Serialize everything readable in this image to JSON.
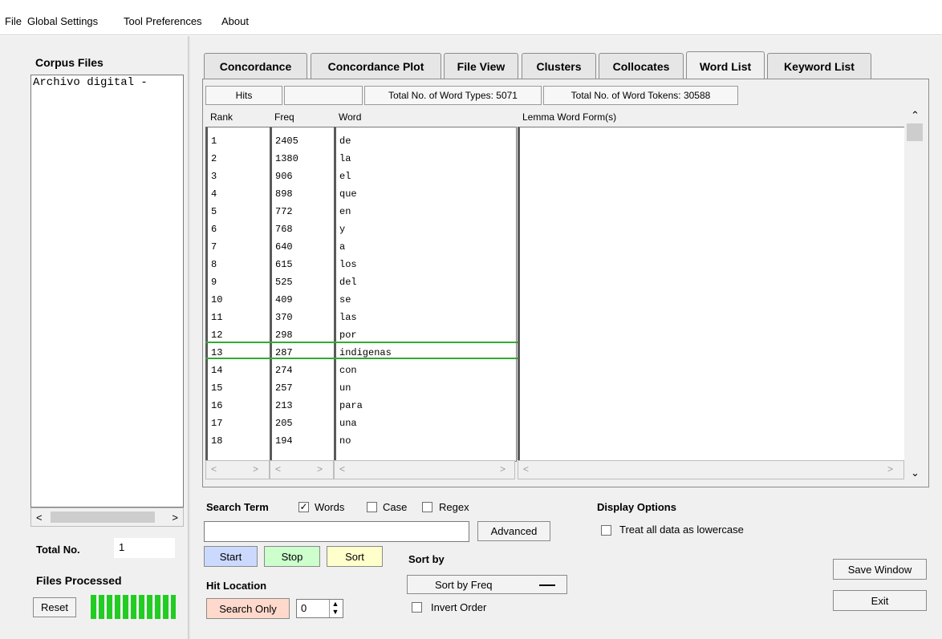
{
  "menu": [
    "File",
    "Global Settings",
    "Tool Preferences",
    "About"
  ],
  "sidebar": {
    "title": "Corpus Files",
    "file_item": "Archivo digital -",
    "total_label": "Total No.",
    "total_value": "1",
    "processed_label": "Files Processed",
    "reset_label": "Reset",
    "progress": 1.0
  },
  "tabs": [
    "Concordance",
    "Concordance Plot",
    "File View",
    "Clusters",
    "Collocates",
    "Word List",
    "Keyword List"
  ],
  "active_tab": "Word List",
  "stats": {
    "hits_label": "Hits",
    "hits_value": "",
    "types": "Total No. of Word Types: 5071",
    "tokens": "Total No. of Word Tokens: 30588"
  },
  "columns": {
    "rank": "Rank",
    "freq": "Freq",
    "word": "Word",
    "lemma": "Lemma Word Form(s)"
  },
  "rows": [
    {
      "rank": "1",
      "freq": "2405",
      "word": "de"
    },
    {
      "rank": "2",
      "freq": "1380",
      "word": "la"
    },
    {
      "rank": "3",
      "freq": "906",
      "word": "el"
    },
    {
      "rank": "4",
      "freq": "898",
      "word": "que"
    },
    {
      "rank": "5",
      "freq": "772",
      "word": "en"
    },
    {
      "rank": "6",
      "freq": "768",
      "word": "y"
    },
    {
      "rank": "7",
      "freq": "640",
      "word": "a"
    },
    {
      "rank": "8",
      "freq": "615",
      "word": "los"
    },
    {
      "rank": "9",
      "freq": "525",
      "word": "del"
    },
    {
      "rank": "10",
      "freq": "409",
      "word": "se"
    },
    {
      "rank": "11",
      "freq": "370",
      "word": "las"
    },
    {
      "rank": "12",
      "freq": "298",
      "word": "por"
    },
    {
      "rank": "13",
      "freq": "287",
      "word": "indigenas"
    },
    {
      "rank": "14",
      "freq": "274",
      "word": "con"
    },
    {
      "rank": "15",
      "freq": "257",
      "word": "un"
    },
    {
      "rank": "16",
      "freq": "213",
      "word": "para"
    },
    {
      "rank": "17",
      "freq": "205",
      "word": "una"
    },
    {
      "rank": "18",
      "freq": "194",
      "word": "no"
    }
  ],
  "selected_rank": "13",
  "search": {
    "term_label": "Search Term",
    "words_label": "Words",
    "words_checked": true,
    "case_label": "Case",
    "case_checked": false,
    "regex_label": "Regex",
    "regex_checked": false,
    "input_value": "",
    "advanced_label": "Advanced"
  },
  "buttons": {
    "start": "Start",
    "stop": "Stop",
    "sort": "Sort",
    "save_window": "Save Window",
    "exit": "Exit"
  },
  "hit_location": {
    "label": "Hit Location",
    "search_only": "Search Only",
    "spinner_value": "0"
  },
  "sort_by": {
    "label": "Sort by",
    "selected": "Sort by Freq",
    "invert_label": "Invert Order",
    "invert_checked": false
  },
  "display": {
    "title": "Display Options",
    "lowercase_label": "Treat all data as lowercase",
    "lowercase_checked": false
  },
  "colors": {
    "start_bg": "#ccd9ff",
    "stop_bg": "#ccffcc",
    "sort_bg": "#ffffcc",
    "search_only_bg": "#ffd9cc",
    "progress": "#22cc22",
    "selection_border": "#33aa33"
  }
}
